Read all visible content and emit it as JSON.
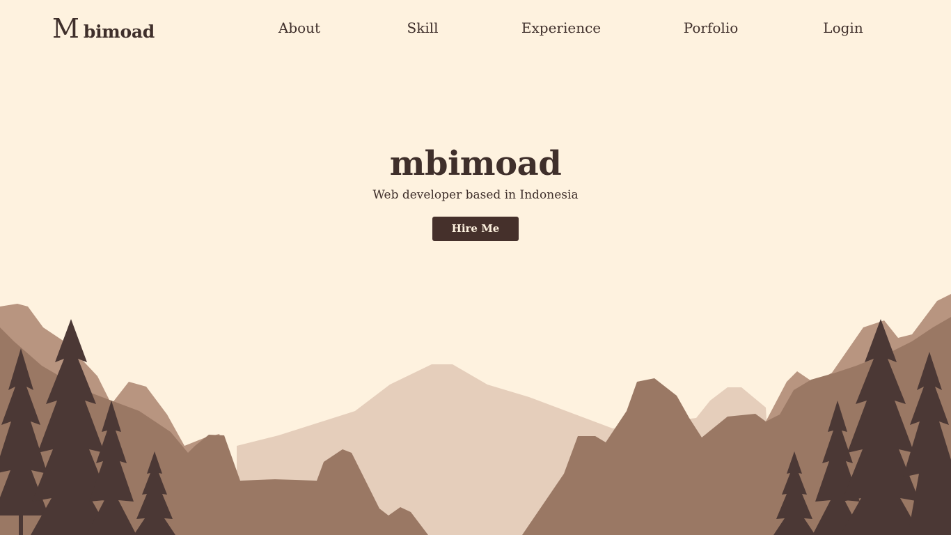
{
  "brand": {
    "mark": "M",
    "name": "bimoad"
  },
  "nav": {
    "about": "About",
    "skill": "Skill",
    "experience": "Experience",
    "portfolio": "Porfolio",
    "login": "Login"
  },
  "hero": {
    "title": "mbimoad",
    "subtitle": "Web developer based in Indonesia",
    "cta_label": "Hire Me"
  },
  "colors": {
    "background": "#fef2df",
    "text": "#3f2f2b",
    "button": "#45302b",
    "far_mountain": "#e5cebb",
    "mid_mountain": "#b89580",
    "near_mountain": "#9a7864",
    "trees": "#4b3835"
  }
}
